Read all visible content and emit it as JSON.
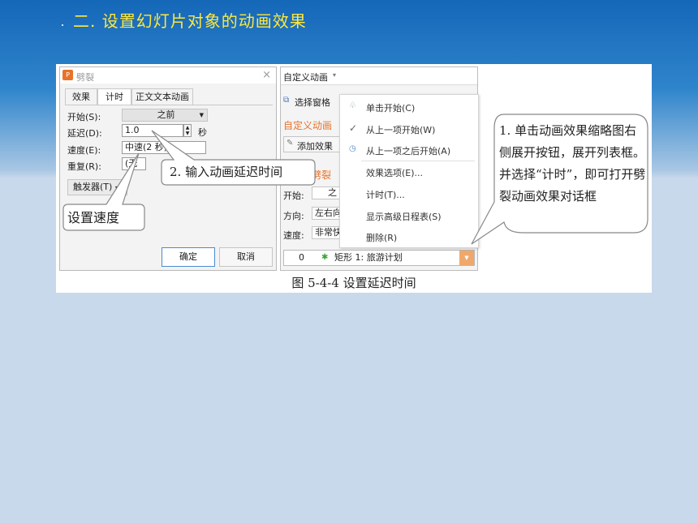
{
  "slide": {
    "title": "二. 设置幻灯片对象的动画效果"
  },
  "dialog": {
    "title": "劈裂",
    "close_glyph": "×",
    "tabs": [
      "效果",
      "计时",
      "正文文本动画"
    ],
    "active_tab": "计时",
    "start_label": "开始(S):",
    "start_value": "之前",
    "delay_label": "延迟(D):",
    "delay_value": "1.0",
    "delay_unit": "秒",
    "speed_label": "速度(E):",
    "speed_value": "中速(2 秒)",
    "repeat_label": "重复(R):",
    "repeat_value": "(无",
    "trigger_button": "触发器(T)",
    "ok_button": "确定",
    "cancel_button": "取消",
    "app_icon_glyph": "P"
  },
  "panel": {
    "title": "自定义动画",
    "select_pane": "选择窗格",
    "custom_anim_heading": "自定义动画",
    "add_effect": "添加效果",
    "effect_heading": "劈裂",
    "start_label": "开始:",
    "start_value": "之",
    "direction_label": "方向:",
    "direction_value": "左右向",
    "speed_label": "速度:",
    "speed_value": "非常快",
    "item_index": "0",
    "item_label": "矩形 1: 旅游计划"
  },
  "context_menu": {
    "items": [
      {
        "label": "单击开始(C)",
        "icon": "mouse-click-icon"
      },
      {
        "label": "从上一项开始(W)",
        "icon": "checkmark-icon"
      },
      {
        "label": "从上一项之后开始(A)",
        "icon": "clock-icon"
      },
      {
        "label": "效果选项(E)...",
        "icon": ""
      },
      {
        "label": "计时(T)...",
        "icon": ""
      },
      {
        "label": "显示高级日程表(S)",
        "icon": ""
      },
      {
        "label": "删除(R)",
        "icon": ""
      }
    ]
  },
  "callouts": {
    "delay": "2. 输入动画延迟时间",
    "speed": "设置速度",
    "instruction": "1. 单击动画效果缩略图右侧展开按钮，展开列表框。并选择“计时”，即可打开劈裂动画效果对话框"
  },
  "caption": "图 5-4-4  设置延迟时间",
  "colors": {
    "title_yellow": "#ffe83a",
    "accent_orange": "#e8722a",
    "background_blue": "#1567b8"
  }
}
